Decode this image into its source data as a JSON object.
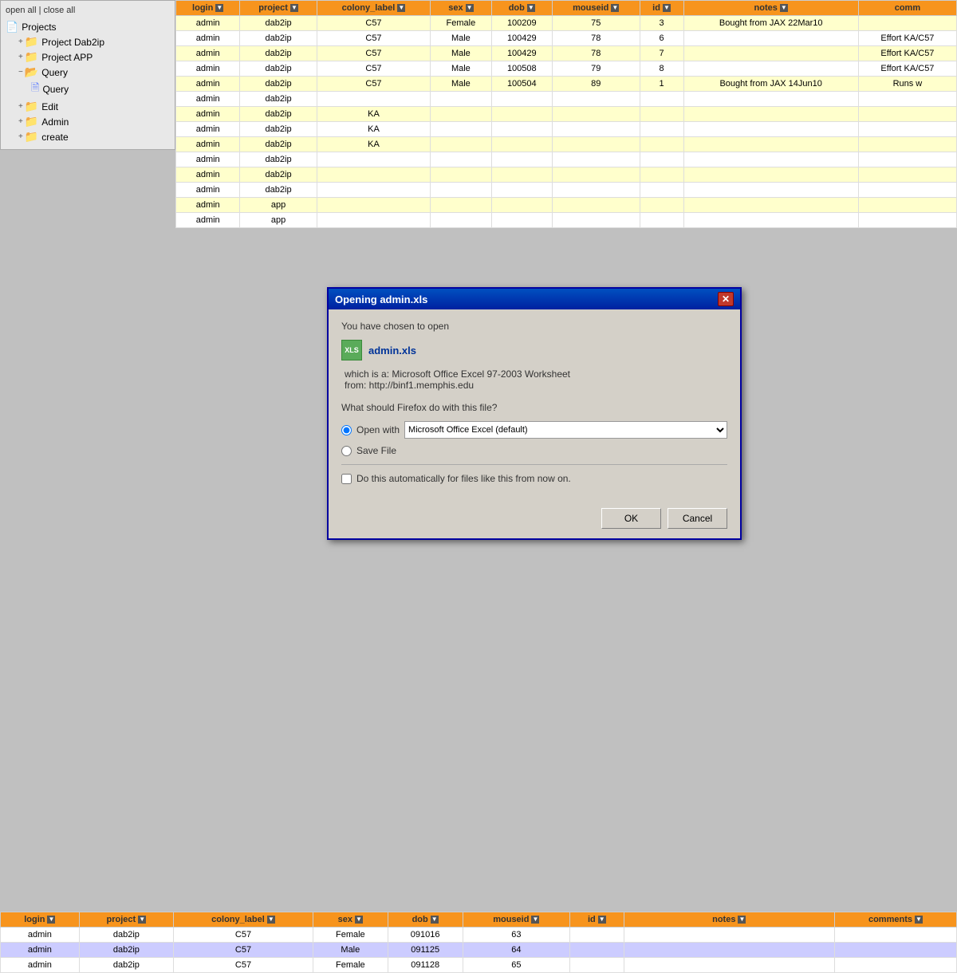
{
  "sidebar": {
    "toplinks": {
      "open_all": "open all",
      "separator": " | ",
      "close_all": "close all"
    },
    "items": [
      {
        "id": "projects-root",
        "label": "Projects",
        "level": 0,
        "icon": "root",
        "expanded": true
      },
      {
        "id": "project-dab2ip",
        "label": "Project Dab2ip",
        "level": 1,
        "icon": "folder",
        "expanded": true
      },
      {
        "id": "project-app",
        "label": "Project APP",
        "level": 1,
        "icon": "folder",
        "expanded": false
      },
      {
        "id": "query-folder",
        "label": "Query",
        "level": 1,
        "icon": "folder",
        "expanded": true
      },
      {
        "id": "query-item",
        "label": "Query",
        "level": 2,
        "icon": "doc",
        "expanded": false
      },
      {
        "id": "edit-folder",
        "label": "Edit",
        "level": 1,
        "icon": "folder",
        "expanded": false
      },
      {
        "id": "admin-folder",
        "label": "Admin",
        "level": 1,
        "icon": "folder",
        "expanded": false
      },
      {
        "id": "create-folder",
        "label": "create",
        "level": 1,
        "icon": "folder",
        "expanded": false
      }
    ]
  },
  "top_table": {
    "columns": [
      "login",
      "project",
      "colony_label",
      "sex",
      "dob",
      "mouseid",
      "id",
      "notes",
      "comm"
    ],
    "rows": [
      {
        "login": "admin",
        "project": "dab2ip",
        "colony": "C57",
        "sex": "Female",
        "dob": "100209",
        "mouseid": "75",
        "id": "3",
        "notes": "Bought from JAX 22Mar10",
        "comments": "",
        "style": "row-yellow"
      },
      {
        "login": "admin",
        "project": "dab2ip",
        "colony": "C57",
        "sex": "Male",
        "dob": "100429",
        "mouseid": "78",
        "id": "6",
        "notes": "",
        "comments": "Effort KA/C57",
        "style": "row-white"
      },
      {
        "login": "admin",
        "project": "dab2ip",
        "colony": "C57",
        "sex": "Male",
        "dob": "100429",
        "mouseid": "78",
        "id": "7",
        "notes": "",
        "comments": "Effort KA/C57",
        "style": "row-yellow"
      },
      {
        "login": "admin",
        "project": "dab2ip",
        "colony": "C57",
        "sex": "Male",
        "dob": "100508",
        "mouseid": "79",
        "id": "8",
        "notes": "",
        "comments": "Effort KA/C57",
        "style": "row-white"
      },
      {
        "login": "admin",
        "project": "dab2ip",
        "colony": "C57",
        "sex": "Male",
        "dob": "100504",
        "mouseid": "89",
        "id": "1",
        "notes": "Bought from JAX 14Jun10",
        "comments": "Runs w",
        "style": "row-yellow"
      },
      {
        "login": "admin",
        "project": "dab2ip",
        "colony": "",
        "sex": "",
        "dob": "",
        "mouseid": "",
        "id": "",
        "notes": "",
        "comments": "",
        "style": "row-white"
      },
      {
        "login": "admin",
        "project": "dab2ip",
        "colony": "KA",
        "sex": "",
        "dob": "",
        "mouseid": "",
        "id": "",
        "notes": "",
        "comments": "",
        "style": "row-yellow"
      },
      {
        "login": "admin",
        "project": "dab2ip",
        "colony": "KA",
        "sex": "",
        "dob": "",
        "mouseid": "",
        "id": "",
        "notes": "",
        "comments": "",
        "style": "row-white"
      },
      {
        "login": "admin",
        "project": "dab2ip",
        "colony": "KA",
        "sex": "",
        "dob": "",
        "mouseid": "",
        "id": "",
        "notes": "",
        "comments": "",
        "style": "row-yellow"
      },
      {
        "login": "admin",
        "project": "dab2ip",
        "colony": "",
        "sex": "",
        "dob": "",
        "mouseid": "",
        "id": "",
        "notes": "",
        "comments": "",
        "style": "row-white"
      },
      {
        "login": "admin",
        "project": "dab2ip",
        "colony": "",
        "sex": "",
        "dob": "",
        "mouseid": "",
        "id": "",
        "notes": "",
        "comments": "",
        "style": "row-yellow"
      },
      {
        "login": "admin",
        "project": "dab2ip",
        "colony": "",
        "sex": "",
        "dob": "",
        "mouseid": "",
        "id": "",
        "notes": "",
        "comments": "",
        "style": "row-white"
      },
      {
        "login": "admin",
        "project": "app",
        "colony": "",
        "sex": "",
        "dob": "",
        "mouseid": "",
        "id": "",
        "notes": "",
        "comments": "",
        "style": "row-yellow"
      },
      {
        "login": "admin",
        "project": "app",
        "colony": "",
        "sex": "",
        "dob": "",
        "mouseid": "",
        "id": "",
        "notes": "",
        "comments": "",
        "style": "row-white"
      }
    ]
  },
  "dialog": {
    "title": "Opening admin.xls",
    "message": "You have chosen to open",
    "file_icon_text": "XLS",
    "file_name": "admin.xls",
    "file_type_label": "which is a: Microsoft Office Excel 97-2003 Worksheet",
    "file_source_label": "from: http://binf1.memphis.edu",
    "question": "What should Firefox do with this file?",
    "open_with_label": "Open with",
    "open_with_value": "Microsoft Office Excel (default)",
    "save_file_label": "Save File",
    "auto_label": "Do this automatically for files like this from now on.",
    "ok_label": "OK",
    "cancel_label": "Cancel"
  },
  "bottom_table": {
    "columns": [
      "login",
      "project",
      "colony_label",
      "sex",
      "dob",
      "mouseid",
      "id",
      "notes",
      "comments"
    ],
    "rows": [
      {
        "login": "admin",
        "project": "dab2ip",
        "colony": "C57",
        "sex": "Female",
        "dob": "091016",
        "mouseid": "63",
        "id": "",
        "notes": "",
        "comments": "",
        "style": "row-white2"
      },
      {
        "login": "admin",
        "project": "dab2ip",
        "colony": "C57",
        "sex": "Male",
        "dob": "091125",
        "mouseid": "64",
        "id": "",
        "notes": "",
        "comments": "",
        "style": "row-purple"
      },
      {
        "login": "admin",
        "project": "dab2ip",
        "colony": "C57",
        "sex": "Female",
        "dob": "091128",
        "mouseid": "65",
        "id": "",
        "notes": "",
        "comments": "",
        "style": "row-white2"
      }
    ]
  }
}
